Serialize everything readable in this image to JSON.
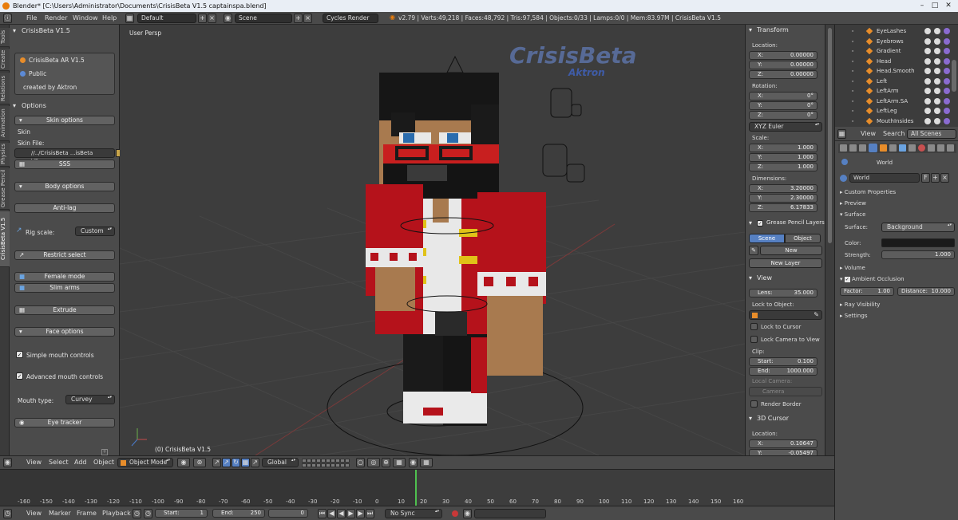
{
  "window": {
    "title": "Blender* [C:\\Users\\Administrator\\Documents\\CrisisBeta V1.5 captainspa.blend]"
  },
  "topbar": {
    "menus": [
      "File",
      "Render",
      "Window",
      "Help"
    ],
    "layout": "Default",
    "scene": "Scene",
    "engine": "Cycles Render",
    "stats": "v2.79 | Verts:49,218 | Faces:48,792 | Tris:97,584 | Objects:0/33 | Lamps:0/0 | Mem:83.97M | CrisisBeta V1.5"
  },
  "left_tabs": [
    "Tools",
    "Create",
    "Relations",
    "Animation",
    "Physics",
    "Grease Pencil",
    "CrisisBeta V1.5"
  ],
  "tool_panel": {
    "header": "CrisisBeta V1.5",
    "info": [
      "CrisisBeta AR V1.5",
      "Public",
      "created by Aktron"
    ],
    "options_header": "Options",
    "skin_options": "Skin options",
    "skin_label": "Skin",
    "skin_file_label": "Skin File:",
    "skin_file": "//../CrisisBeta ...isBeta V2.png",
    "sss": "SSS",
    "body_options": "Body options",
    "anti_lag": "Anti-lag",
    "rig_scale_label": "Rig scale:",
    "rig_scale": "Custom",
    "restrict_select": "Restrict select",
    "female_mode": "Female mode",
    "slim_arms": "Slim arms",
    "extrude": "Extrude",
    "face_options": "Face options",
    "simple_mouth": "Simple mouth controls",
    "advanced_mouth": "Advanced mouth controls",
    "mouth_type_label": "Mouth type:",
    "mouth_type": "Curvey",
    "eye_tracker": "Eye tracker"
  },
  "viewport": {
    "view_label": "User Persp",
    "object_label": "(0) CrisisBeta V1.5",
    "logo_top": "CrisisBeta",
    "logo_bottom": "Aktron"
  },
  "npanel": {
    "transform": "Transform",
    "location": "Location:",
    "loc": [
      {
        "k": "X:",
        "v": "0.00000"
      },
      {
        "k": "Y:",
        "v": "0.00000"
      },
      {
        "k": "Z:",
        "v": "0.00000"
      }
    ],
    "rotation": "Rotation:",
    "rot": [
      {
        "k": "X:",
        "v": "0°"
      },
      {
        "k": "Y:",
        "v": "0°"
      },
      {
        "k": "Z:",
        "v": "0°"
      }
    ],
    "rot_mode": "XYZ Euler",
    "scale": "Scale:",
    "scl": [
      {
        "k": "X:",
        "v": "1.000"
      },
      {
        "k": "Y:",
        "v": "1.000"
      },
      {
        "k": "Z:",
        "v": "1.000"
      }
    ],
    "dimensions": "Dimensions:",
    "dim": [
      {
        "k": "X:",
        "v": "3.20000"
      },
      {
        "k": "Y:",
        "v": "2.30000"
      },
      {
        "k": "Z:",
        "v": "6.17833"
      }
    ],
    "gp_layers": "Grease Pencil Layers",
    "gp_scene": "Scene",
    "gp_object": "Object",
    "gp_new": "New",
    "gp_new_layer": "New Layer",
    "view": "View",
    "lens_k": "Lens:",
    "lens_v": "35.000",
    "lock_to_object": "Lock to Object:",
    "lock_to_cursor": "Lock to Cursor",
    "lock_camera": "Lock Camera to View",
    "clip": "Clip:",
    "clip_start_k": "Start:",
    "clip_start_v": "0.100",
    "clip_end_k": "End:",
    "clip_end_v": "1000.000",
    "local_camera": "Local Camera:",
    "camera": "Camera",
    "render_border": "Render Border",
    "cursor_3d": "3D Cursor",
    "cursor_location": "Location:",
    "cursor": [
      {
        "k": "X:",
        "v": "0.10647"
      },
      {
        "k": "Y:",
        "v": "-0.05497"
      }
    ]
  },
  "outliner": {
    "items": [
      "EyeLashes",
      "Eyebrows",
      "Gradient",
      "Head",
      "Head.Smooth",
      "Left",
      "LeftArm",
      "LeftArm.SA",
      "LeftLeg",
      "MouthInsides"
    ]
  },
  "properties": {
    "view_menu": "View",
    "search_menu": "Search",
    "all_scenes": "All Scenes",
    "world_crumb": "World",
    "world_field": "World",
    "world_f": "F",
    "sections": [
      "Custom Properties",
      "Preview",
      "Surface",
      "Volume",
      "Ambient Occlusion",
      "Ray Visibility",
      "Settings"
    ],
    "surface_label": "Surface:",
    "surface_value": "Background",
    "color_label": "Color:",
    "color_value": "#1a1a1a",
    "strength_k": "Strength:",
    "strength_v": "1.000",
    "ao_factor_k": "Factor:",
    "ao_factor_v": "1.00",
    "ao_distance_k": "Distance:",
    "ao_distance_v": "10.000"
  },
  "view_header": {
    "menus": [
      "View",
      "Select",
      "Add",
      "Object"
    ],
    "mode": "Object Mode",
    "orientation": "Global"
  },
  "timeline": {
    "ticks": [
      "-160",
      "-150",
      "-140",
      "-130",
      "-120",
      "-110",
      "-100",
      "-90",
      "-80",
      "-70",
      "-60",
      "-50",
      "-40",
      "-30",
      "-20",
      "-10",
      "0",
      "10",
      "20",
      "30",
      "40",
      "50",
      "60",
      "70",
      "80",
      "90",
      "100",
      "110",
      "120",
      "130",
      "140",
      "150",
      "160"
    ]
  },
  "timeline_bar": {
    "menus": [
      "View",
      "Marker",
      "Frame",
      "Playback"
    ],
    "start_k": "Start:",
    "start_v": "1",
    "end_k": "End:",
    "end_v": "250",
    "current": "0",
    "sync": "No Sync"
  },
  "colors": {
    "accent": "#5680c2",
    "panel": "#4b4b4b",
    "viewport": "#3d3d3d",
    "red": "#b5121b"
  }
}
